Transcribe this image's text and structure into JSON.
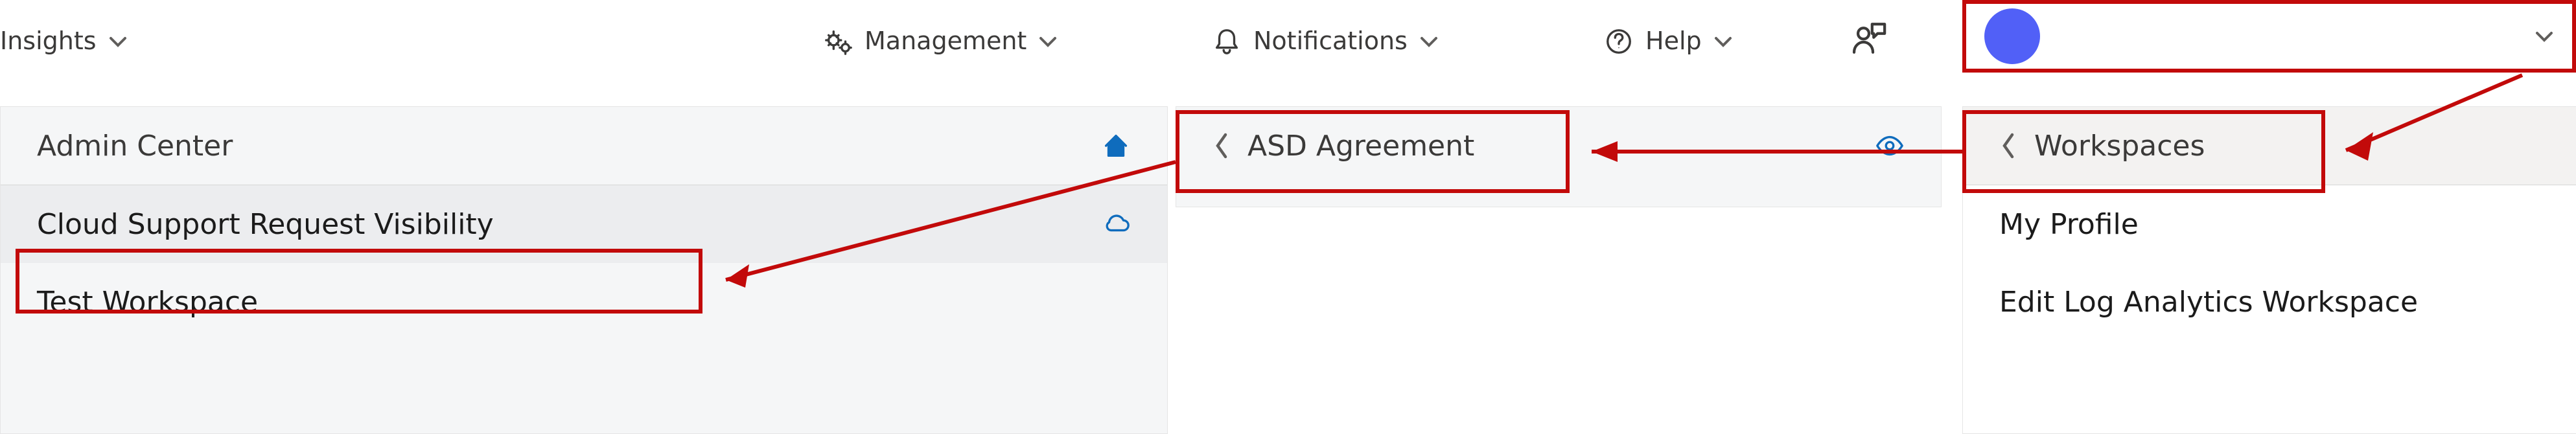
{
  "topnav": {
    "insights": {
      "label": "Insights"
    },
    "management": {
      "label": "Management"
    },
    "notifications": {
      "label": "Notifications"
    },
    "help": {
      "label": "Help"
    }
  },
  "panels": {
    "left": {
      "header": "Admin Center",
      "rows": [
        {
          "label": "Cloud Support Request Visibility"
        },
        {
          "label": "Test Workspace"
        }
      ]
    },
    "mid": {
      "header": "ASD Agreement"
    },
    "right": {
      "header": "Workspaces",
      "rows": [
        {
          "label": "My Profile"
        },
        {
          "label": "Edit Log Analytics Workspace"
        }
      ]
    }
  }
}
